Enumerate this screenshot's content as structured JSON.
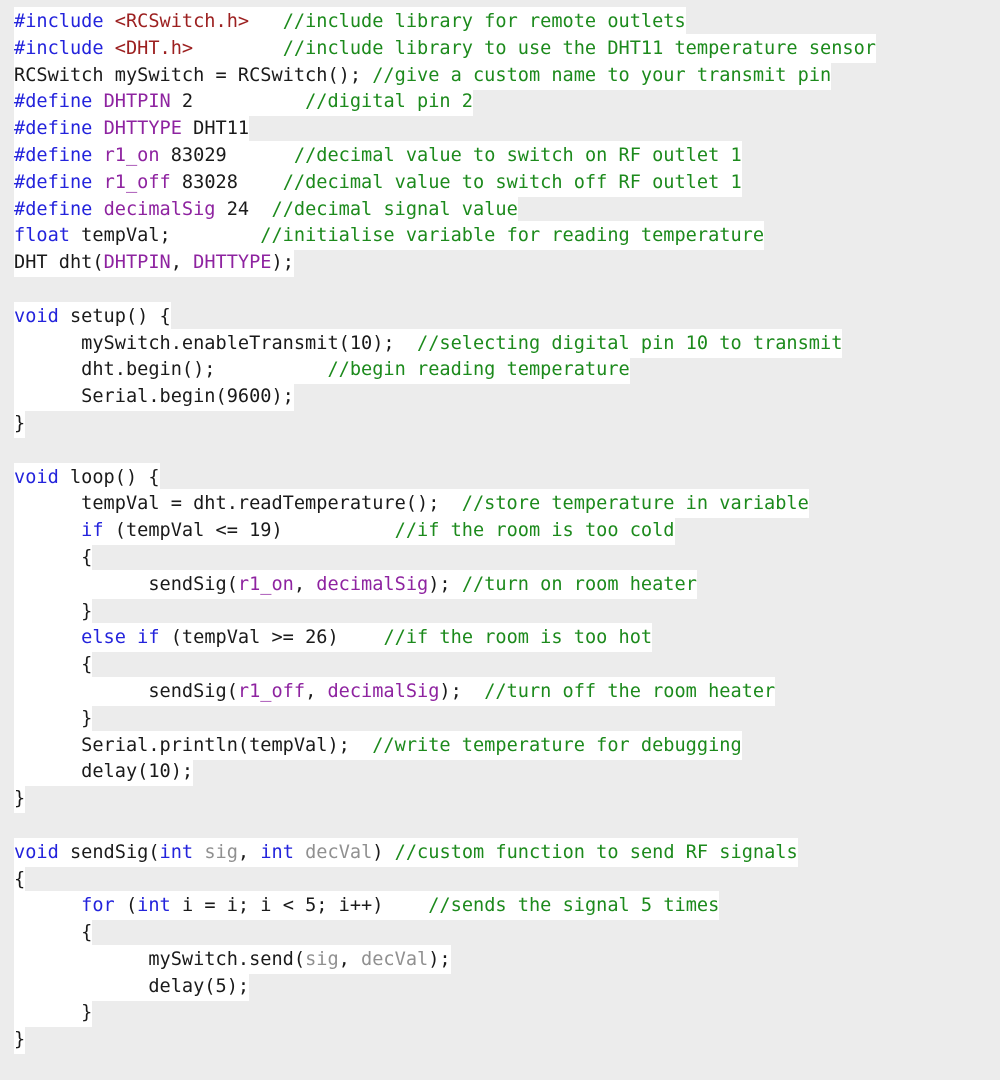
{
  "document": {
    "kind": "source-code-listing",
    "language": "Arduino C++",
    "background_color": "#ececec",
    "line_background_color": "#ffffff"
  },
  "palette": {
    "keyword": "#2323dc",
    "include_target": "#9c2020",
    "macro": "#8e23a0",
    "comment": "#1c8a1c",
    "parameter": "#909090",
    "plain": "#1a1a1a"
  },
  "code": {
    "lines": [
      {
        "blank": false,
        "tokens": [
          {
            "t": "#include ",
            "c": "kw"
          },
          {
            "t": "<RCSwitch.h>",
            "c": "inc"
          },
          {
            "t": "   ",
            "c": "pln"
          },
          {
            "t": "//include library for remote outlets",
            "c": "cmt"
          }
        ]
      },
      {
        "blank": false,
        "tokens": [
          {
            "t": "#include ",
            "c": "kw"
          },
          {
            "t": "<DHT.h>",
            "c": "inc"
          },
          {
            "t": "        ",
            "c": "pln"
          },
          {
            "t": "//include library to use the DHT11 temperature sensor",
            "c": "cmt"
          }
        ]
      },
      {
        "blank": false,
        "tokens": [
          {
            "t": "RCSwitch mySwitch = RCSwitch(); ",
            "c": "pln"
          },
          {
            "t": "//give a custom name to your transmit pin",
            "c": "cmt"
          }
        ]
      },
      {
        "blank": false,
        "tokens": [
          {
            "t": "#define ",
            "c": "kw"
          },
          {
            "t": "DHTPIN",
            "c": "mac"
          },
          {
            "t": " 2",
            "c": "pln"
          },
          {
            "t": "          ",
            "c": "pln"
          },
          {
            "t": "//digital pin 2",
            "c": "cmt"
          }
        ]
      },
      {
        "blank": false,
        "tokens": [
          {
            "t": "#define ",
            "c": "kw"
          },
          {
            "t": "DHTTYPE",
            "c": "mac"
          },
          {
            "t": " DHT11",
            "c": "pln"
          }
        ]
      },
      {
        "blank": false,
        "tokens": [
          {
            "t": "#define ",
            "c": "kw"
          },
          {
            "t": "r1_on",
            "c": "mac"
          },
          {
            "t": " 83029",
            "c": "pln"
          },
          {
            "t": "      ",
            "c": "pln"
          },
          {
            "t": "//decimal value to switch on RF outlet 1",
            "c": "cmt"
          }
        ]
      },
      {
        "blank": false,
        "tokens": [
          {
            "t": "#define ",
            "c": "kw"
          },
          {
            "t": "r1_off",
            "c": "mac"
          },
          {
            "t": " 83028",
            "c": "pln"
          },
          {
            "t": "    ",
            "c": "pln"
          },
          {
            "t": "//decimal value to switch off RF outlet 1",
            "c": "cmt"
          }
        ]
      },
      {
        "blank": false,
        "tokens": [
          {
            "t": "#define ",
            "c": "kw"
          },
          {
            "t": "decimalSig",
            "c": "mac"
          },
          {
            "t": " 24",
            "c": "pln"
          },
          {
            "t": "  ",
            "c": "pln"
          },
          {
            "t": "//decimal signal value",
            "c": "cmt"
          }
        ]
      },
      {
        "blank": false,
        "tokens": [
          {
            "t": "float",
            "c": "kw"
          },
          {
            "t": " tempVal;",
            "c": "pln"
          },
          {
            "t": "        ",
            "c": "pln"
          },
          {
            "t": "//initialise variable for reading temperature",
            "c": "cmt"
          }
        ]
      },
      {
        "blank": false,
        "tokens": [
          {
            "t": "DHT dht(",
            "c": "pln"
          },
          {
            "t": "DHTPIN",
            "c": "mac"
          },
          {
            "t": ", ",
            "c": "pln"
          },
          {
            "t": "DHTTYPE",
            "c": "mac"
          },
          {
            "t": ");",
            "c": "pln"
          }
        ]
      },
      {
        "blank": true,
        "tokens": []
      },
      {
        "blank": false,
        "tokens": [
          {
            "t": "void",
            "c": "kw"
          },
          {
            "t": " setup() {",
            "c": "pln"
          }
        ]
      },
      {
        "blank": false,
        "tokens": [
          {
            "t": "      mySwitch.enableTransmit(10);",
            "c": "pln"
          },
          {
            "t": "  ",
            "c": "pln"
          },
          {
            "t": "//selecting digital pin 10 to transmit",
            "c": "cmt"
          }
        ]
      },
      {
        "blank": false,
        "tokens": [
          {
            "t": "      dht.begin();",
            "c": "pln"
          },
          {
            "t": "          ",
            "c": "pln"
          },
          {
            "t": "//begin reading temperature",
            "c": "cmt"
          }
        ]
      },
      {
        "blank": false,
        "tokens": [
          {
            "t": "      Serial.begin(9600);",
            "c": "pln"
          }
        ]
      },
      {
        "blank": false,
        "tokens": [
          {
            "t": "}",
            "c": "pln"
          }
        ]
      },
      {
        "blank": true,
        "tokens": []
      },
      {
        "blank": false,
        "tokens": [
          {
            "t": "void",
            "c": "kw"
          },
          {
            "t": " loop() {",
            "c": "pln"
          }
        ]
      },
      {
        "blank": false,
        "tokens": [
          {
            "t": "      tempVal = dht.readTemperature();",
            "c": "pln"
          },
          {
            "t": "  ",
            "c": "pln"
          },
          {
            "t": "//store temperature in variable",
            "c": "cmt"
          }
        ]
      },
      {
        "blank": false,
        "tokens": [
          {
            "t": "      ",
            "c": "pln"
          },
          {
            "t": "if",
            "c": "kw"
          },
          {
            "t": " (tempVal <= 19)",
            "c": "pln"
          },
          {
            "t": "          ",
            "c": "pln"
          },
          {
            "t": "//if the room is too cold",
            "c": "cmt"
          }
        ]
      },
      {
        "blank": false,
        "tokens": [
          {
            "t": "      {",
            "c": "pln"
          }
        ]
      },
      {
        "blank": false,
        "tokens": [
          {
            "t": "            sendSig(",
            "c": "pln"
          },
          {
            "t": "r1_on",
            "c": "mac"
          },
          {
            "t": ", ",
            "c": "pln"
          },
          {
            "t": "decimalSig",
            "c": "mac"
          },
          {
            "t": "); ",
            "c": "pln"
          },
          {
            "t": "//turn on room heater",
            "c": "cmt"
          }
        ]
      },
      {
        "blank": false,
        "tokens": [
          {
            "t": "      }",
            "c": "pln"
          }
        ]
      },
      {
        "blank": false,
        "tokens": [
          {
            "t": "      ",
            "c": "pln"
          },
          {
            "t": "else",
            "c": "kw"
          },
          {
            "t": " ",
            "c": "pln"
          },
          {
            "t": "if",
            "c": "kw"
          },
          {
            "t": " (tempVal >= 26)",
            "c": "pln"
          },
          {
            "t": "    ",
            "c": "pln"
          },
          {
            "t": "//if the room is too hot",
            "c": "cmt"
          }
        ]
      },
      {
        "blank": false,
        "tokens": [
          {
            "t": "      {",
            "c": "pln"
          }
        ]
      },
      {
        "blank": false,
        "tokens": [
          {
            "t": "            sendSig(",
            "c": "pln"
          },
          {
            "t": "r1_off",
            "c": "mac"
          },
          {
            "t": ", ",
            "c": "pln"
          },
          {
            "t": "decimalSig",
            "c": "mac"
          },
          {
            "t": ");  ",
            "c": "pln"
          },
          {
            "t": "//turn off the room heater",
            "c": "cmt"
          }
        ]
      },
      {
        "blank": false,
        "tokens": [
          {
            "t": "      }",
            "c": "pln"
          }
        ]
      },
      {
        "blank": false,
        "tokens": [
          {
            "t": "      Serial.println(tempVal);",
            "c": "pln"
          },
          {
            "t": "  ",
            "c": "pln"
          },
          {
            "t": "//write temperature for debugging",
            "c": "cmt"
          }
        ]
      },
      {
        "blank": false,
        "tokens": [
          {
            "t": "      delay(10);",
            "c": "pln"
          }
        ]
      },
      {
        "blank": false,
        "tokens": [
          {
            "t": "}",
            "c": "pln"
          }
        ]
      },
      {
        "blank": true,
        "tokens": []
      },
      {
        "blank": false,
        "tokens": [
          {
            "t": "void",
            "c": "kw"
          },
          {
            "t": " sendSig(",
            "c": "pln"
          },
          {
            "t": "int",
            "c": "kw"
          },
          {
            "t": " ",
            "c": "pln"
          },
          {
            "t": "sig",
            "c": "par"
          },
          {
            "t": ", ",
            "c": "pln"
          },
          {
            "t": "int",
            "c": "kw"
          },
          {
            "t": " ",
            "c": "pln"
          },
          {
            "t": "decVal",
            "c": "par"
          },
          {
            "t": ") ",
            "c": "pln"
          },
          {
            "t": "//custom function to send RF signals",
            "c": "cmt"
          }
        ]
      },
      {
        "blank": false,
        "tokens": [
          {
            "t": "{",
            "c": "pln"
          }
        ]
      },
      {
        "blank": false,
        "tokens": [
          {
            "t": "      ",
            "c": "pln"
          },
          {
            "t": "for",
            "c": "kw"
          },
          {
            "t": " (",
            "c": "pln"
          },
          {
            "t": "int",
            "c": "kw"
          },
          {
            "t": " i = i; i < 5; i++)",
            "c": "pln"
          },
          {
            "t": "    ",
            "c": "pln"
          },
          {
            "t": "//sends the signal 5 times",
            "c": "cmt"
          }
        ]
      },
      {
        "blank": false,
        "tokens": [
          {
            "t": "      {",
            "c": "pln"
          }
        ]
      },
      {
        "blank": false,
        "tokens": [
          {
            "t": "            mySwitch.send(",
            "c": "pln"
          },
          {
            "t": "sig",
            "c": "par"
          },
          {
            "t": ", ",
            "c": "pln"
          },
          {
            "t": "decVal",
            "c": "par"
          },
          {
            "t": ");",
            "c": "pln"
          }
        ]
      },
      {
        "blank": false,
        "tokens": [
          {
            "t": "            delay(5);",
            "c": "pln"
          }
        ]
      },
      {
        "blank": false,
        "tokens": [
          {
            "t": "      }",
            "c": "pln"
          }
        ]
      },
      {
        "blank": false,
        "tokens": [
          {
            "t": "}",
            "c": "pln"
          }
        ]
      }
    ]
  }
}
